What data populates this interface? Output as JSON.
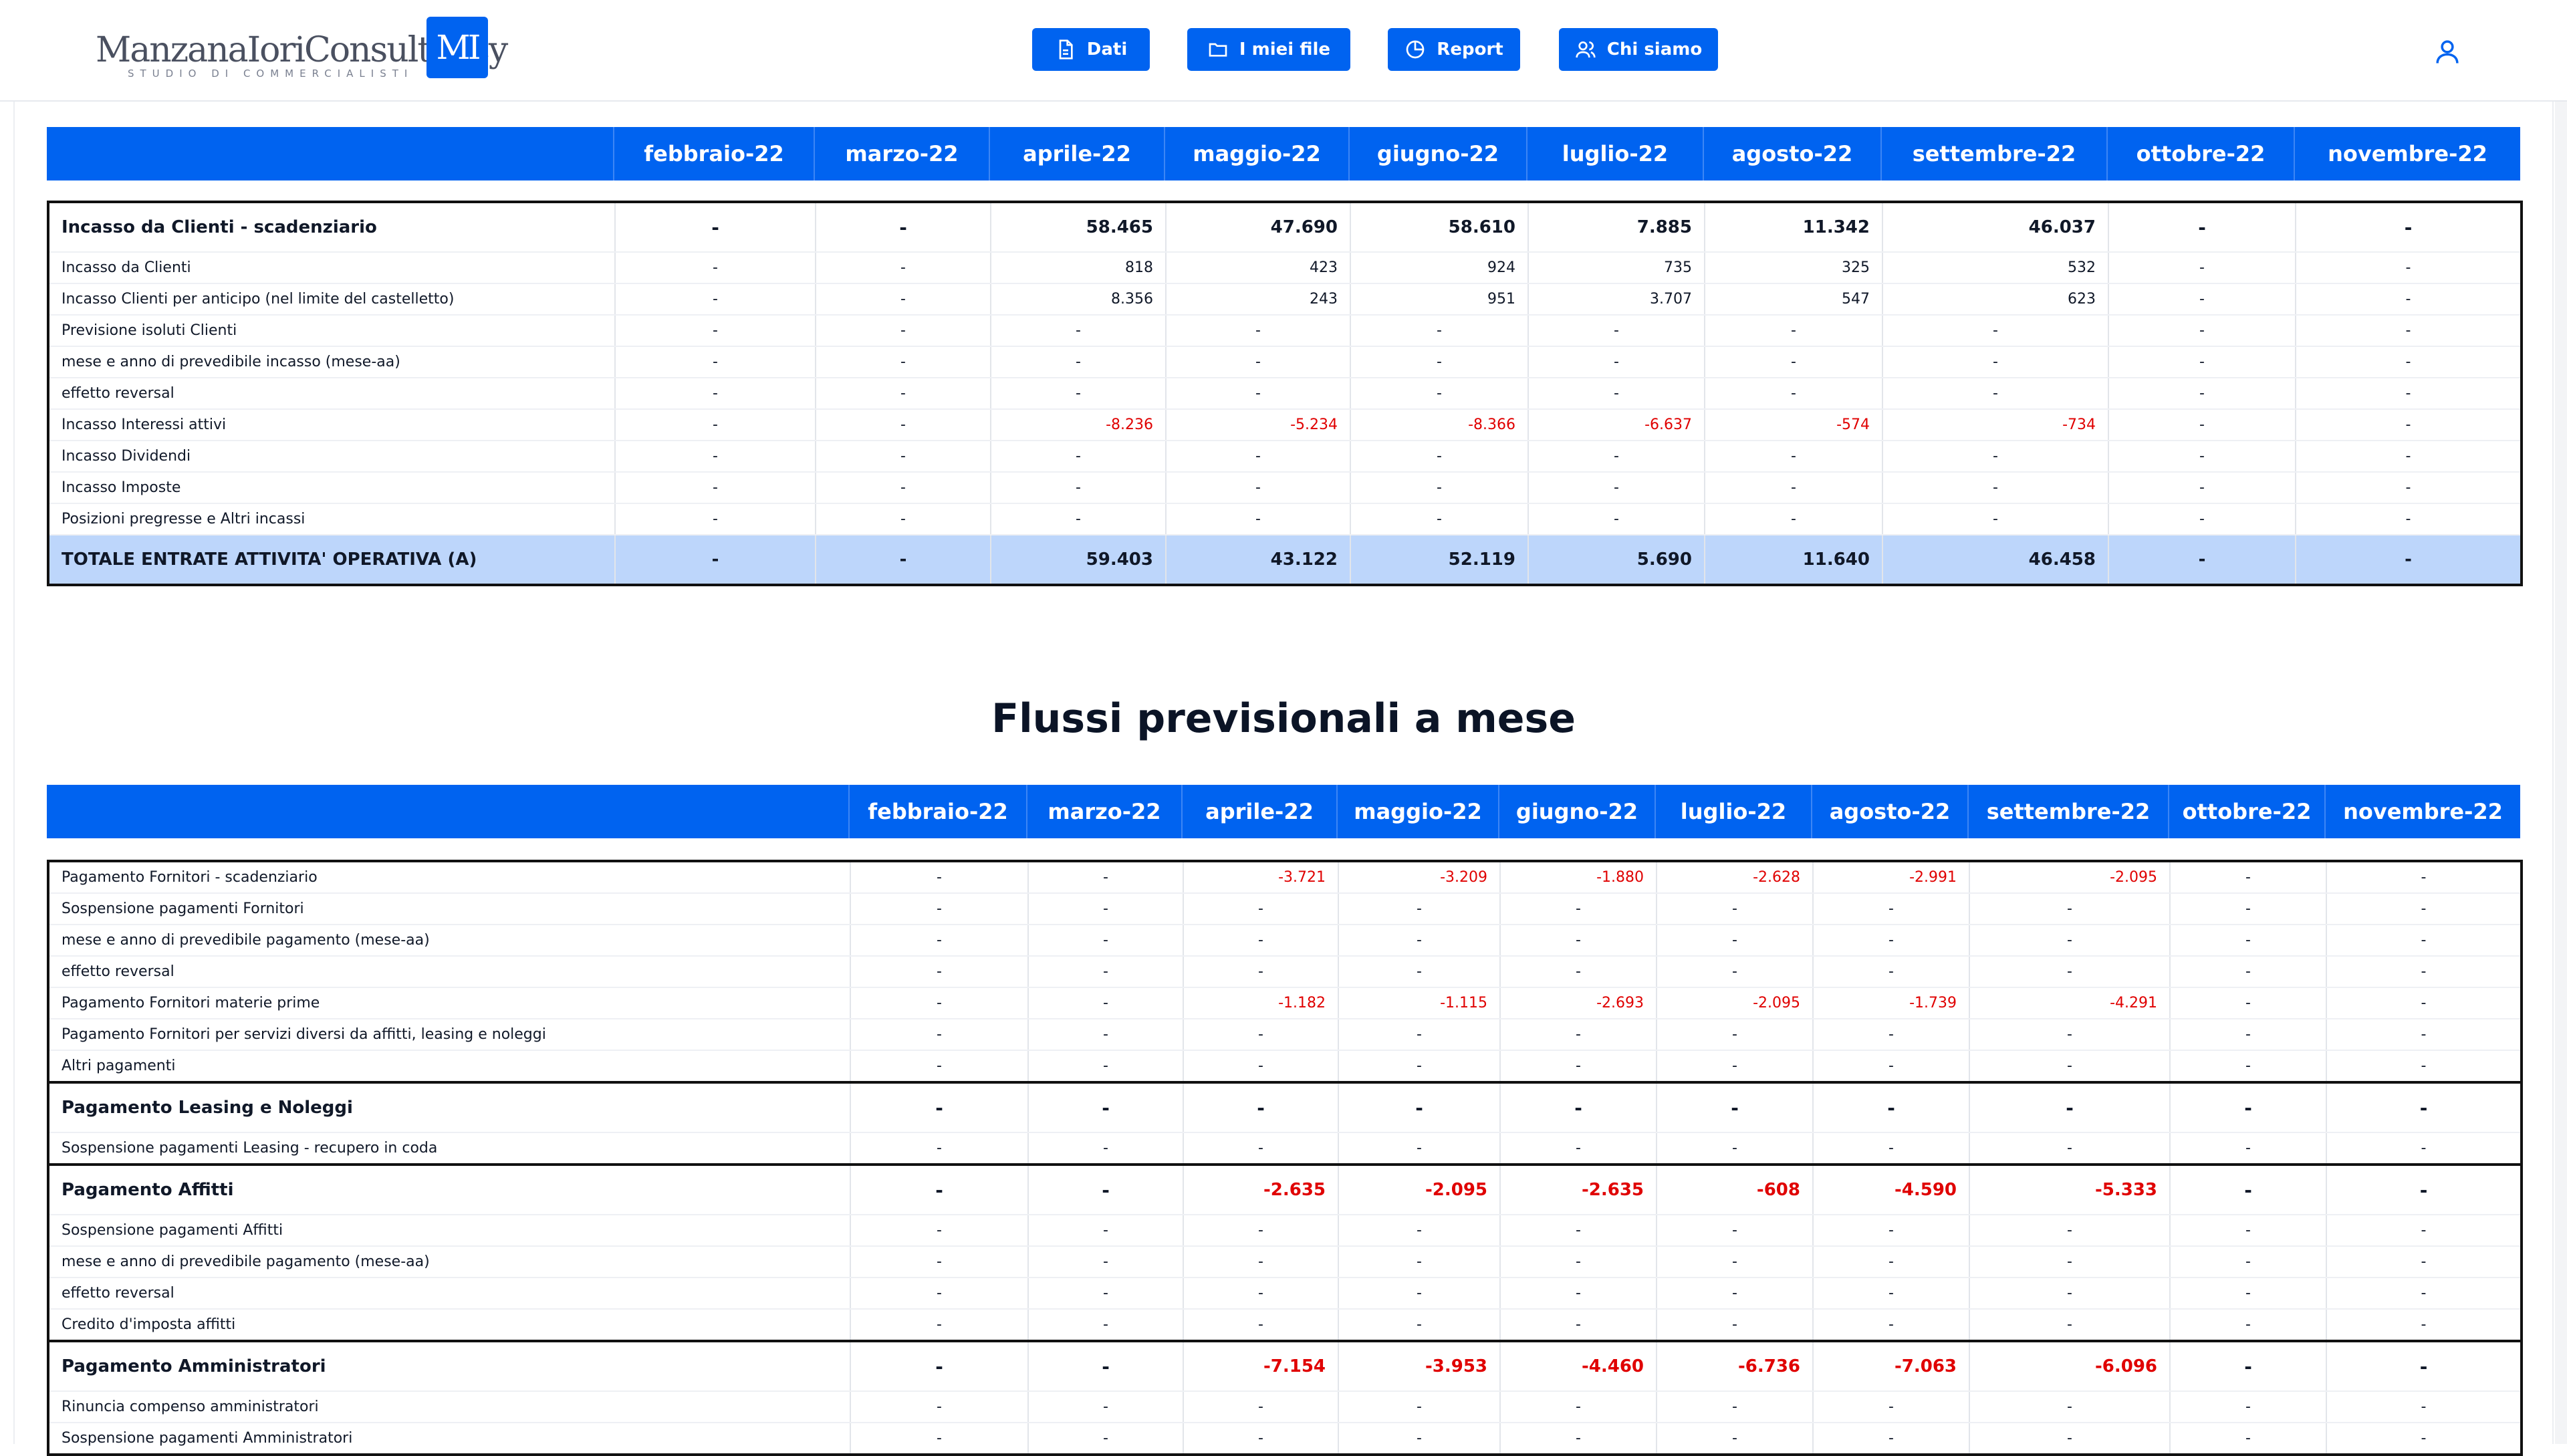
{
  "header": {
    "logo_text": "ManzanaIoriConsultancy",
    "logo_subtitle": "STUDIO DI COMMERCIALISTI",
    "logo_mark": "MI",
    "nav": [
      {
        "label": "Dati",
        "icon": "document-icon"
      },
      {
        "label": "I miei file",
        "icon": "folder-icon"
      },
      {
        "label": "Report",
        "icon": "pie-chart-icon"
      },
      {
        "label": "Chi siamo",
        "icon": "users-icon"
      }
    ],
    "user_icon": "user-icon"
  },
  "colors": {
    "primary": "#0063f0",
    "total_row": "#bdd6fb",
    "negative": "#e00000"
  },
  "months": [
    "febbraio-22",
    "marzo-22",
    "aprile-22",
    "maggio-22",
    "giugno-22",
    "luglio-22",
    "agosto-22",
    "settembre-22",
    "ottobre-22",
    "novembre-22"
  ],
  "table1": {
    "rows": [
      {
        "label": "Incasso da Clienti - scadenziario",
        "type": "bold",
        "values": [
          "-",
          "-",
          "58.465",
          "47.690",
          "58.610",
          "7.885",
          "11.342",
          "46.037",
          "-",
          "-"
        ]
      },
      {
        "label": "Incasso da Clienti",
        "values": [
          "-",
          "-",
          "818",
          "423",
          "924",
          "735",
          "325",
          "532",
          "-",
          "-"
        ]
      },
      {
        "label": "Incasso Clienti per anticipo (nel limite del castelletto)",
        "values": [
          "-",
          "-",
          "8.356",
          "243",
          "951",
          "3.707",
          "547",
          "623",
          "-",
          "-"
        ]
      },
      {
        "label": "Previsione isoluti Clienti",
        "values": [
          "-",
          "-",
          "-",
          "-",
          "-",
          "-",
          "-",
          "-",
          "-",
          "-"
        ]
      },
      {
        "label": "mese e anno di prevedibile incasso (mese-aa)",
        "values": [
          "-",
          "-",
          "-",
          "-",
          "-",
          "-",
          "-",
          "-",
          "-",
          "-"
        ]
      },
      {
        "label": "effetto reversal",
        "values": [
          "-",
          "-",
          "-",
          "-",
          "-",
          "-",
          "-",
          "-",
          "-",
          "-"
        ]
      },
      {
        "label": "Incasso Interessi attivi",
        "values": [
          "-",
          "-",
          "-8.236",
          "-5.234",
          "-8.366",
          "-6.637",
          "-574",
          "-734",
          "-",
          "-"
        ]
      },
      {
        "label": "Incasso Dividendi",
        "values": [
          "-",
          "-",
          "-",
          "-",
          "-",
          "-",
          "-",
          "-",
          "-",
          "-"
        ]
      },
      {
        "label": "Incasso Imposte",
        "values": [
          "-",
          "-",
          "-",
          "-",
          "-",
          "-",
          "-",
          "-",
          "-",
          "-"
        ]
      },
      {
        "label": "Posizioni pregresse e Altri incassi",
        "values": [
          "-",
          "-",
          "-",
          "-",
          "-",
          "-",
          "-",
          "-",
          "-",
          "-"
        ]
      },
      {
        "label": "TOTALE ENTRATE ATTIVITA' OPERATIVA (A)",
        "type": "total",
        "values": [
          "-",
          "-",
          "59.403",
          "43.122",
          "52.119",
          "5.690",
          "11.640",
          "46.458",
          "-",
          "-"
        ]
      }
    ]
  },
  "section_title": "Flussi previsionali a mese",
  "table2": {
    "rows": [
      {
        "label": "Pagamento Fornitori - scadenziario",
        "values": [
          "-",
          "-",
          "-3.721",
          "-3.209",
          "-1.880",
          "-2.628",
          "-2.991",
          "-2.095",
          "-",
          "-"
        ]
      },
      {
        "label": "Sospensione pagamenti Fornitori",
        "values": [
          "-",
          "-",
          "-",
          "-",
          "-",
          "-",
          "-",
          "-",
          "-",
          "-"
        ]
      },
      {
        "label": "mese e anno di prevedibile pagamento (mese-aa)",
        "values": [
          "-",
          "-",
          "-",
          "-",
          "-",
          "-",
          "-",
          "-",
          "-",
          "-"
        ]
      },
      {
        "label": "effetto reversal",
        "values": [
          "-",
          "-",
          "-",
          "-",
          "-",
          "-",
          "-",
          "-",
          "-",
          "-"
        ]
      },
      {
        "label": "Pagamento Fornitori materie prime",
        "values": [
          "-",
          "-",
          "-1.182",
          "-1.115",
          "-2.693",
          "-2.095",
          "-1.739",
          "-4.291",
          "-",
          "-"
        ]
      },
      {
        "label": "Pagamento Fornitori per servizi diversi da affitti, leasing e noleggi",
        "values": [
          "-",
          "-",
          "-",
          "-",
          "-",
          "-",
          "-",
          "-",
          "-",
          "-"
        ]
      },
      {
        "label": "Altri pagamenti",
        "values": [
          "-",
          "-",
          "-",
          "-",
          "-",
          "-",
          "-",
          "-",
          "-",
          "-"
        ]
      },
      {
        "label": "Pagamento Leasing e Noleggi",
        "type": "bold",
        "sep": true,
        "values": [
          "-",
          "-",
          "-",
          "-",
          "-",
          "-",
          "-",
          "-",
          "-",
          "-"
        ]
      },
      {
        "label": "Sospensione pagamenti Leasing - recupero in coda",
        "values": [
          "-",
          "-",
          "-",
          "-",
          "-",
          "-",
          "-",
          "-",
          "-",
          "-"
        ]
      },
      {
        "label": "Pagamento Affitti",
        "type": "bold",
        "sep": true,
        "values": [
          "-",
          "-",
          "-2.635",
          "-2.095",
          "-2.635",
          "-608",
          "-4.590",
          "-5.333",
          "-",
          "-"
        ]
      },
      {
        "label": "Sospensione pagamenti Affitti",
        "values": [
          "-",
          "-",
          "-",
          "-",
          "-",
          "-",
          "-",
          "-",
          "-",
          "-"
        ]
      },
      {
        "label": "mese e anno di prevedibile pagamento (mese-aa)",
        "values": [
          "-",
          "-",
          "-",
          "-",
          "-",
          "-",
          "-",
          "-",
          "-",
          "-"
        ]
      },
      {
        "label": "effetto reversal",
        "values": [
          "-",
          "-",
          "-",
          "-",
          "-",
          "-",
          "-",
          "-",
          "-",
          "-"
        ]
      },
      {
        "label": "Credito d'imposta affitti",
        "values": [
          "-",
          "-",
          "-",
          "-",
          "-",
          "-",
          "-",
          "-",
          "-",
          "-"
        ]
      },
      {
        "label": "Pagamento Amministratori",
        "type": "bold",
        "sep": true,
        "values": [
          "-",
          "-",
          "-7.154",
          "-3.953",
          "-4.460",
          "-6.736",
          "-7.063",
          "-6.096",
          "-",
          "-"
        ]
      },
      {
        "label": "Rinuncia compenso amministratori",
        "values": [
          "-",
          "-",
          "-",
          "-",
          "-",
          "-",
          "-",
          "-",
          "-",
          "-"
        ]
      },
      {
        "label": "Sospensione pagamenti Amministratori",
        "values": [
          "-",
          "-",
          "-",
          "-",
          "-",
          "-",
          "-",
          "-",
          "-",
          "-"
        ]
      }
    ]
  }
}
